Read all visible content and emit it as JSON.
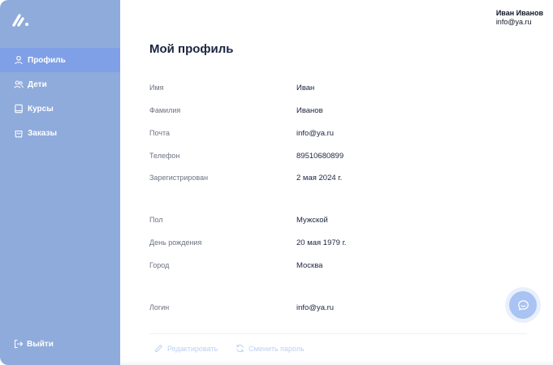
{
  "header": {
    "user_name": "Иван Иванов",
    "user_email": "info@ya.ru"
  },
  "sidebar": {
    "items": [
      {
        "label": "Профиль",
        "icon": "user-icon",
        "active": true
      },
      {
        "label": "Дети",
        "icon": "users-icon",
        "active": false
      },
      {
        "label": "Курсы",
        "icon": "book-icon",
        "active": false
      },
      {
        "label": "Заказы",
        "icon": "shopping-bag-icon",
        "active": false
      }
    ],
    "logout_label": "Выйти"
  },
  "main": {
    "title": "Мой профиль",
    "fields": [
      {
        "label": "Имя",
        "value": "Иван"
      },
      {
        "label": "Фамилия",
        "value": "Иванов"
      },
      {
        "label": "Почта",
        "value": "info@ya.ru"
      },
      {
        "label": "Телефон",
        "value": "89510680899"
      },
      {
        "label": "Зарегистрирован",
        "value": "2 мая 2024 г."
      },
      {
        "label": "Пол",
        "value": "Мужской"
      },
      {
        "label": "День рождения",
        "value": "20 мая 1979 г."
      },
      {
        "label": "Город",
        "value": "Москва"
      },
      {
        "label": "Логин",
        "value": "info@ya.ru"
      }
    ],
    "actions": {
      "edit_label": "Редактировать",
      "change_password_label": "Сменить пароль"
    }
  },
  "colors": {
    "sidebar_bg": "#8fabdb",
    "sidebar_active": "#7fa0e6",
    "accent_light": "#bdd0f2",
    "chat_button": "#a9c3f2"
  }
}
